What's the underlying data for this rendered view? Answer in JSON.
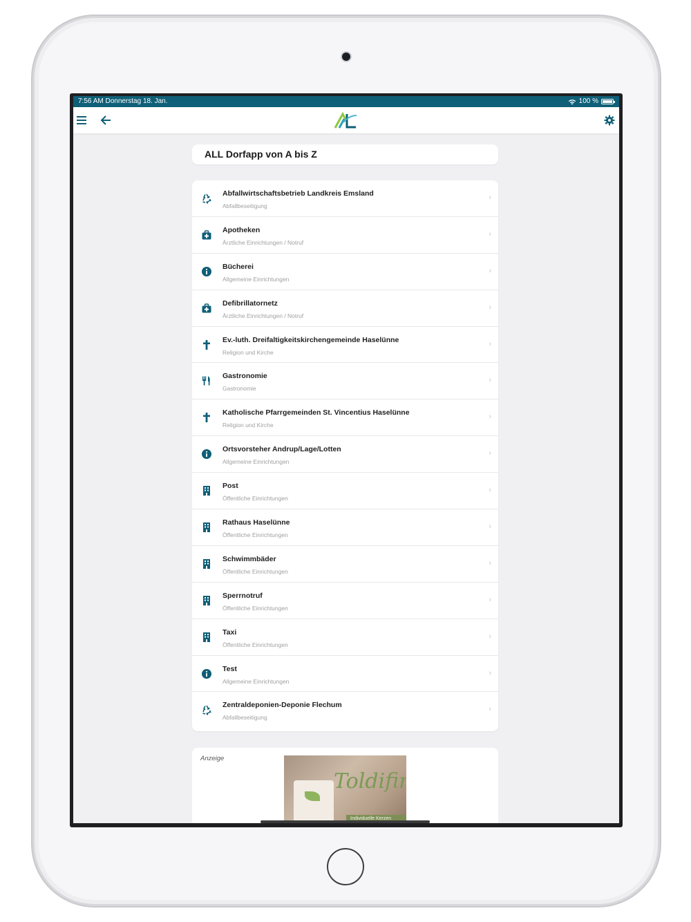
{
  "statusbar": {
    "time_date": "7:56 AM   Donnerstag 18. Jan.",
    "battery": "100 %"
  },
  "navbar": {
    "menu_icon": "hamburger-menu-icon",
    "back_icon": "arrow-left-icon",
    "logo_text": "AL",
    "settings_icon": "gear-icon"
  },
  "page": {
    "title": "ALL Dorfapp von A bis Z"
  },
  "list": [
    {
      "title": "Abfallwirtschaftsbetrieb Landkreis Emsland",
      "subtitle": "Abfallbeseitigung",
      "icon": "recycle-icon"
    },
    {
      "title": "Apotheken",
      "subtitle": "Ärztliche Einrichtungen / Notruf",
      "icon": "medical-kit-icon"
    },
    {
      "title": "Bücherei",
      "subtitle": "Allgemeine Einrichtungen",
      "icon": "info-icon"
    },
    {
      "title": "Defibrillatornetz",
      "subtitle": "Ärztliche Einrichtungen / Notruf",
      "icon": "medical-kit-icon"
    },
    {
      "title": "Ev.-luth. Dreifaltigkeitskirchengemeinde Haselünne",
      "subtitle": "Religion und Kirche",
      "icon": "cross-icon"
    },
    {
      "title": "Gastronomie",
      "subtitle": "Gastronomie",
      "icon": "utensils-icon"
    },
    {
      "title": "Katholische Pfarrgemeinden St. Vincentius Haselünne",
      "subtitle": "Religion und Kirche",
      "icon": "cross-icon"
    },
    {
      "title": "Ortsvorsteher Andrup/Lage/Lotten",
      "subtitle": "Allgemeine Einrichtungen",
      "icon": "info-icon"
    },
    {
      "title": "Post",
      "subtitle": "Öffentliche Einrichtungen",
      "icon": "building-icon"
    },
    {
      "title": "Rathaus Haselünne",
      "subtitle": "Öffentliche Einrichtungen",
      "icon": "building-icon"
    },
    {
      "title": "Schwimmbäder",
      "subtitle": "Öffentliche Einrichtungen",
      "icon": "building-icon"
    },
    {
      "title": "Sperrnotruf",
      "subtitle": "Öffentliche Einrichtungen",
      "icon": "building-icon"
    },
    {
      "title": "Taxi",
      "subtitle": "Öffentliche Einrichtungen",
      "icon": "building-icon"
    },
    {
      "title": "Test",
      "subtitle": "Allgemeine Einrichtungen",
      "icon": "info-icon"
    },
    {
      "title": "Zentraldeponien-Deponie Flechum",
      "subtitle": "Abfallbeseitigung",
      "icon": "recycle-icon"
    }
  ],
  "ad": {
    "label": "Anzeige",
    "brand": "Toldifin",
    "strip_text": "Individuelle Kerzen"
  },
  "colors": {
    "accent": "#0e5f77",
    "background": "#f0f0f2"
  }
}
